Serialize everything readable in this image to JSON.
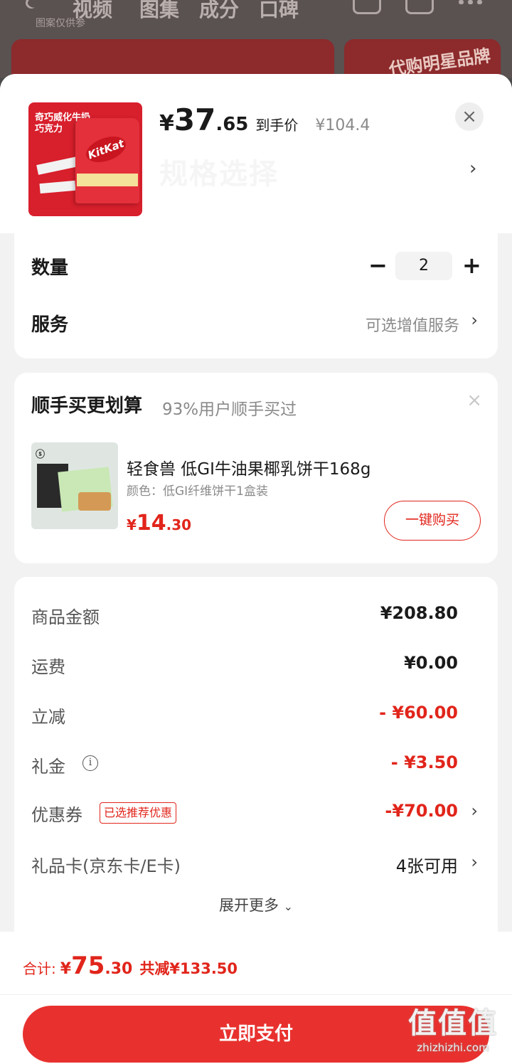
{
  "background": {
    "tabs": [
      "视频",
      "图集",
      "成分",
      "口碑"
    ],
    "note": "图案仅供参",
    "banner_text": "代购明星品牌"
  },
  "product": {
    "image_text": "奇巧威化牛奶巧克力",
    "brand_on_image": "KitKat",
    "price_currency": "¥",
    "price_int": "37",
    "price_dec": ".65",
    "price_tag": "到手价",
    "original_price": "¥104.4",
    "faded_title": "规格选择"
  },
  "quantity": {
    "label": "数量",
    "value": "2",
    "minus": "−",
    "plus": "+"
  },
  "service": {
    "label": "服务",
    "value": "可选增值服务"
  },
  "upsell": {
    "title": "顺手买更划算",
    "subtitle": "93%用户顺手买过",
    "item_name": "轻食兽 低GI牛油果椰乳饼干168g",
    "item_spec": "颜色：低GI纤维饼干1盒装",
    "price_currency": "¥",
    "price_int": "14",
    "price_dec": ".30",
    "buy_label": "一键购买"
  },
  "summary": {
    "rows": [
      {
        "label": "商品金额",
        "value": "¥208.80"
      },
      {
        "label": "运费",
        "value": "¥0.00"
      },
      {
        "label": "立减",
        "value": "- ¥60.00"
      },
      {
        "label": "礼金",
        "value": "- ¥3.50"
      },
      {
        "label": "优惠券",
        "value": "-¥70.00",
        "badge": "已选推荐优惠"
      },
      {
        "label": "礼品卡(京东卡/E卡)",
        "value": "4张可用"
      }
    ],
    "expand_label": "展开更多"
  },
  "footer": {
    "total_label": "合计:",
    "total_currency": "¥",
    "total_int": "75",
    "total_dec": ".30",
    "saved": "共减¥133.50",
    "pay_label": "立即支付"
  },
  "watermark": {
    "big": "值值值",
    "small": "zhizhizhi.com"
  },
  "colors": {
    "accent": "#e1251b",
    "pay_button": "#e8312e"
  }
}
